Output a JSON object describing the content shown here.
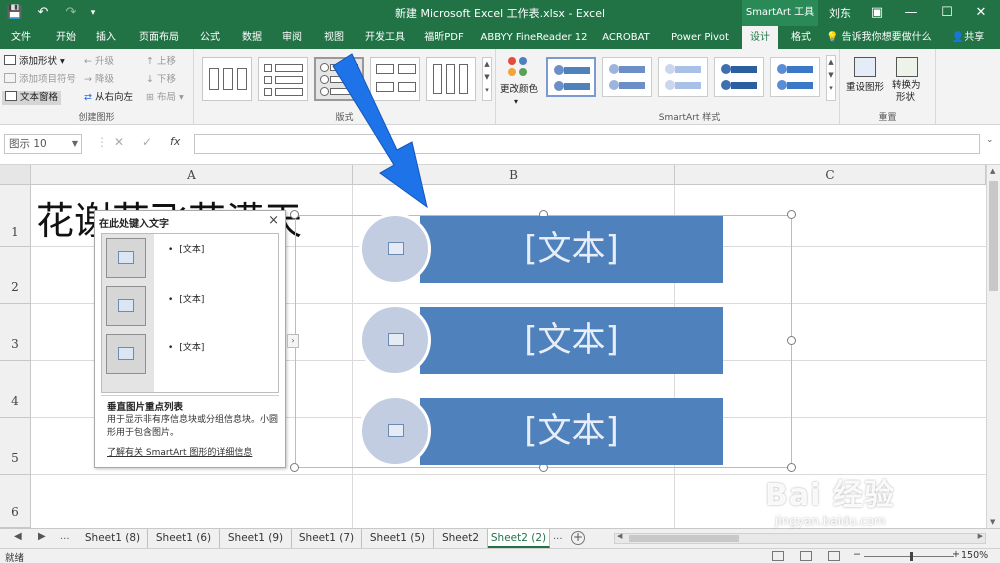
{
  "titlebar": {
    "title": "新建 Microsoft Excel 工作表.xlsx  -  Excel",
    "context_tab": "SmartArt 工具",
    "user": "刘东",
    "qa_save": "💾",
    "qa_undo": "↶",
    "qa_redo": "↷",
    "qa_more": "▾",
    "ribbon_opts": "▣",
    "minimize": "—",
    "maximize": "☐",
    "close": "✕"
  },
  "tabs": [
    "文件",
    "开始",
    "插入",
    "页面布局",
    "公式",
    "数据",
    "审阅",
    "视图",
    "开发工具",
    "福昕PDF",
    "ABBYY FineReader 12",
    "ACROBAT",
    "Power Pivot",
    "设计",
    "格式"
  ],
  "tell_me": "告诉我你想要做什么",
  "share": "共享",
  "ribbon": {
    "create_group": {
      "label": "创建图形",
      "add_shape": "添加形状",
      "add_bullet": "添加项目符号",
      "text_pane": "文本窗格",
      "promote": "升级",
      "demote": "降级",
      "rtl": "从右向左",
      "move_up": "上移",
      "move_down": "下移",
      "layout": "布局"
    },
    "layouts_group": {
      "label": "版式"
    },
    "change_colors": "更改颜色",
    "styles_group": {
      "label": "SmartArt 样式"
    },
    "reset_group": {
      "label": "重置",
      "reset_graphic": "重设图形",
      "convert_line1": "转换为",
      "convert_line2": "形状"
    }
  },
  "formula_bar": {
    "name_box": "图示 10",
    "cancel": "✕",
    "enter": "✓",
    "fx": "fx",
    "value": ""
  },
  "columns": [
    "A",
    "B",
    "C"
  ],
  "rows": [
    "1",
    "2",
    "3",
    "4",
    "5",
    "6"
  ],
  "cell_a1": "花谢花飞花满天",
  "text_pane": {
    "title": "在此处键入文字",
    "close": "×",
    "bullets": [
      "[文本]",
      "[文本]",
      "[文本]"
    ],
    "layout_name": "垂直图片重点列表",
    "description": "用于显示非有序信息块或分组信息块。小圆形用于包含图片。",
    "link": "了解有关 SmartArt 图形的详细信息",
    "expand": "›"
  },
  "smartart": {
    "items": [
      "[文本]",
      "[文本]",
      "[文本]"
    ]
  },
  "sheets": [
    "Sheet1 (8)",
    "Sheet1 (6)",
    "Sheet1 (9)",
    "Sheet1 (7)",
    "Sheet1 (5)",
    "Sheet2",
    "Sheet2 (2)"
  ],
  "sheet_nav": {
    "prev": "◀",
    "next": "▶",
    "more_left": "...",
    "more_right": "..."
  },
  "add_sheet": "+",
  "status": {
    "ready": "就绪",
    "zoom": "150%",
    "zoom_out": "−",
    "zoom_in": "+"
  },
  "colors": {
    "excel_green": "#217346",
    "shape_blue": "#4f81bd",
    "circle": "#c3cde1",
    "arrow_blue": "#1e73e8"
  },
  "watermark": {
    "text": "Bai 经验",
    "url": "jingyan.baidu.com"
  }
}
